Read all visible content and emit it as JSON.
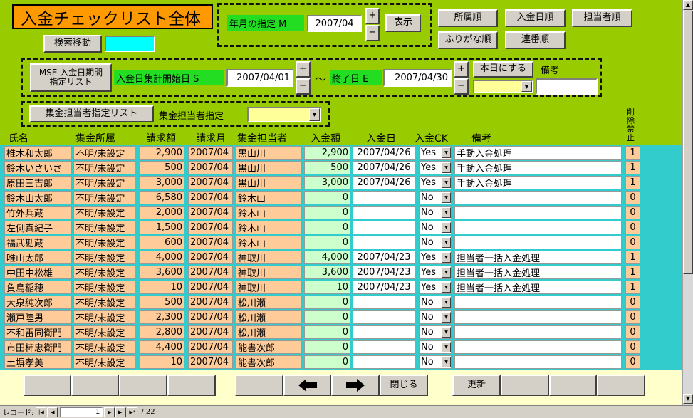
{
  "title": "入金チェックリスト全体",
  "search_move_label": "検索移動",
  "month": {
    "label": "年月の指定 M",
    "value": "2007/04",
    "plus": "+",
    "minus": "−",
    "show_label": "表示"
  },
  "sort": {
    "dept": "所属順",
    "date": "入金日順",
    "person": "担当者順",
    "kana": "ふりがな順",
    "serial": "連番順"
  },
  "range": {
    "button_label": "MSE 入金日期間指定リスト",
    "start_label": "入金日集計開始日 S",
    "start_value": "2007/04/01",
    "tilde": "〜",
    "end_label": "終了日 E",
    "end_value": "2007/04/30",
    "today_label": "本日にする",
    "note_label": "備考",
    "plus": "+",
    "minus": "−"
  },
  "collector": {
    "button_label": "集金担当者指定リスト",
    "label": "集金担当者指定"
  },
  "headers": {
    "name": "氏名",
    "dept": "集金所属",
    "amount": "請求額",
    "month": "請求月",
    "person": "集金担当者",
    "paid": "入金額",
    "pay_date": "入金日",
    "check": "入金CK",
    "note": "備考",
    "delete": "削除禁止"
  },
  "rows": [
    {
      "name": "椎木和太郎",
      "dept": "不明/未設定",
      "amount": "2,900",
      "month": "2007/04",
      "person": "黒山川",
      "paid": "2,900",
      "pay_date": "2007/04/26",
      "check": "Yes",
      "note": "手動入金処理",
      "del": "1"
    },
    {
      "name": "鈴木いさいさ",
      "dept": "不明/未設定",
      "amount": "500",
      "month": "2007/04",
      "person": "黒山川",
      "paid": "500",
      "pay_date": "2007/04/26",
      "check": "Yes",
      "note": "手動入金処理",
      "del": "1"
    },
    {
      "name": "原田三吉郎",
      "dept": "不明/未設定",
      "amount": "3,000",
      "month": "2007/04",
      "person": "黒山川",
      "paid": "3,000",
      "pay_date": "2007/04/26",
      "check": "Yes",
      "note": "手動入金処理",
      "del": "1"
    },
    {
      "name": "鈴木山太郎",
      "dept": "不明/未設定",
      "amount": "6,580",
      "month": "2007/04",
      "person": "鈴木山",
      "paid": "0",
      "pay_date": "",
      "check": "No",
      "note": "",
      "del": "0"
    },
    {
      "name": "竹外兵蔵",
      "dept": "不明/未設定",
      "amount": "2,000",
      "month": "2007/04",
      "person": "鈴木山",
      "paid": "0",
      "pay_date": "",
      "check": "No",
      "note": "",
      "del": "0"
    },
    {
      "name": "左側真紀子",
      "dept": "不明/未設定",
      "amount": "1,500",
      "month": "2007/04",
      "person": "鈴木山",
      "paid": "0",
      "pay_date": "",
      "check": "No",
      "note": "",
      "del": "0"
    },
    {
      "name": "福武勘蔵",
      "dept": "不明/未設定",
      "amount": "600",
      "month": "2007/04",
      "person": "鈴木山",
      "paid": "0",
      "pay_date": "",
      "check": "No",
      "note": "",
      "del": "0"
    },
    {
      "name": "唯山太郎",
      "dept": "不明/未設定",
      "amount": "4,000",
      "month": "2007/04",
      "person": "神取川",
      "paid": "4,000",
      "pay_date": "2007/04/23",
      "check": "Yes",
      "note": "担当者一括入金処理",
      "del": "1"
    },
    {
      "name": "中田中松雄",
      "dept": "不明/未設定",
      "amount": "3,600",
      "month": "2007/04",
      "person": "神取川",
      "paid": "3,600",
      "pay_date": "2007/04/23",
      "check": "Yes",
      "note": "担当者一括入金処理",
      "del": "1"
    },
    {
      "name": "負島稲穂",
      "dept": "不明/未設定",
      "amount": "10",
      "month": "2007/04",
      "person": "神取川",
      "paid": "10",
      "pay_date": "2007/04/23",
      "check": "Yes",
      "note": "担当者一括入金処理",
      "del": "1"
    },
    {
      "name": "大泉純次郎",
      "dept": "不明/未設定",
      "amount": "500",
      "month": "2007/04",
      "person": "松川瀬",
      "paid": "0",
      "pay_date": "",
      "check": "No",
      "note": "",
      "del": "0"
    },
    {
      "name": "瀬戸陸男",
      "dept": "不明/未設定",
      "amount": "2,300",
      "month": "2007/04",
      "person": "松川瀬",
      "paid": "0",
      "pay_date": "",
      "check": "No",
      "note": "",
      "del": "0"
    },
    {
      "name": "不和雷同衛門",
      "dept": "不明/未設定",
      "amount": "2,800",
      "month": "2007/04",
      "person": "松川瀬",
      "paid": "0",
      "pay_date": "",
      "check": "No",
      "note": "",
      "del": "0"
    },
    {
      "name": "市田柿忠衛門",
      "dept": "不明/未設定",
      "amount": "4,400",
      "month": "2007/04",
      "person": "能書次郎",
      "paid": "0",
      "pay_date": "",
      "check": "No",
      "note": "",
      "del": "0"
    },
    {
      "name": "土塀孝美",
      "dept": "不明/未設定",
      "amount": "10",
      "month": "2007/04",
      "person": "能書次郎",
      "paid": "0",
      "pay_date": "",
      "check": "No",
      "note": "",
      "del": "0"
    }
  ],
  "footer": {
    "close_label": "閉じる",
    "update_label": "更新"
  },
  "recbar": {
    "label": "レコード:",
    "current": "1",
    "total": "/ 22"
  }
}
